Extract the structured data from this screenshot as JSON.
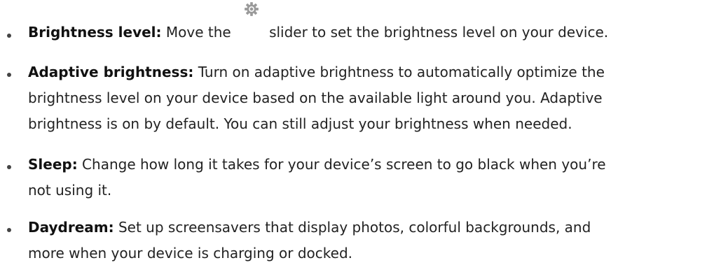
{
  "items": [
    {
      "term": "Brightness level:",
      "text_before_icon": " Move the",
      "icon": "brightness-gear-icon",
      "text_after_icon": "slider to set the brightness level on your device."
    },
    {
      "term": "Adaptive brightness:",
      "lines": [
        " Turn on adaptive brightness to automatically optimize the",
        "brightness level on your device based on the available light around you. Adaptive",
        "brightness is on by default. You can still adjust your brightness when needed."
      ]
    },
    {
      "term": "Sleep:",
      "lines": [
        " Change how long it takes for your device’s screen to go black when you’re",
        "not using it."
      ]
    },
    {
      "term": "Daydream:",
      "lines": [
        " Set up screensavers that display photos, colorful backgrounds, and",
        "more when your device is charging or docked."
      ]
    }
  ],
  "colors": {
    "text": "#222222",
    "icon": "#9a9a9a"
  }
}
